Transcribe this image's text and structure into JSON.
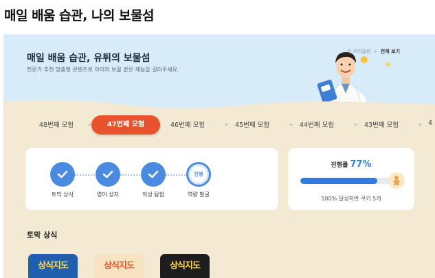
{
  "page": {
    "title": "매일 배움 습관, 나의 보물섬"
  },
  "hero": {
    "title": "매일 배움 습관, 유튀의 보물섬",
    "subtitle": "전문가 추천 맞춤형 콘텐츠로 아이의 보물 같은 재능을 길러주세요.",
    "link_prev": "이 커리큘럼",
    "link_separator": ">",
    "link_all": "전체 보기"
  },
  "rounds": {
    "items": [
      "48번째 모험",
      "47번째 모험",
      "46번째 모험",
      "45번째 모험",
      "44번째 모험",
      "43번째 모험",
      "4"
    ],
    "active": "47번째 모험"
  },
  "steps": {
    "items": [
      {
        "label": "토막 상식",
        "done": true
      },
      {
        "label": "영어 상자",
        "done": true
      },
      {
        "label": "적성 탐험",
        "done": true
      },
      {
        "label": "역량 발굴",
        "done": false,
        "badge": "진행"
      }
    ]
  },
  "progress": {
    "label": "진행률",
    "percent_text": "77%",
    "value": 0.77,
    "note": "100% 달성하면 쿠키 5개"
  },
  "section": {
    "title": "토막 상식"
  },
  "thumbs": [
    {
      "text": "상식지도",
      "bg": "#1f5fae",
      "color": "#ffd54a"
    },
    {
      "text": "상식지도",
      "bg": "#f7e3c2",
      "color": "#e0582f"
    },
    {
      "text": "상식지도",
      "bg": "#1d1d1d",
      "color": "#ffd54a"
    }
  ],
  "colors": {
    "accent": "#e8532e",
    "primary": "#4a8be0",
    "progress": "#2f7de1",
    "background": "#f4e9d3",
    "hero": "#d8ebf8"
  }
}
